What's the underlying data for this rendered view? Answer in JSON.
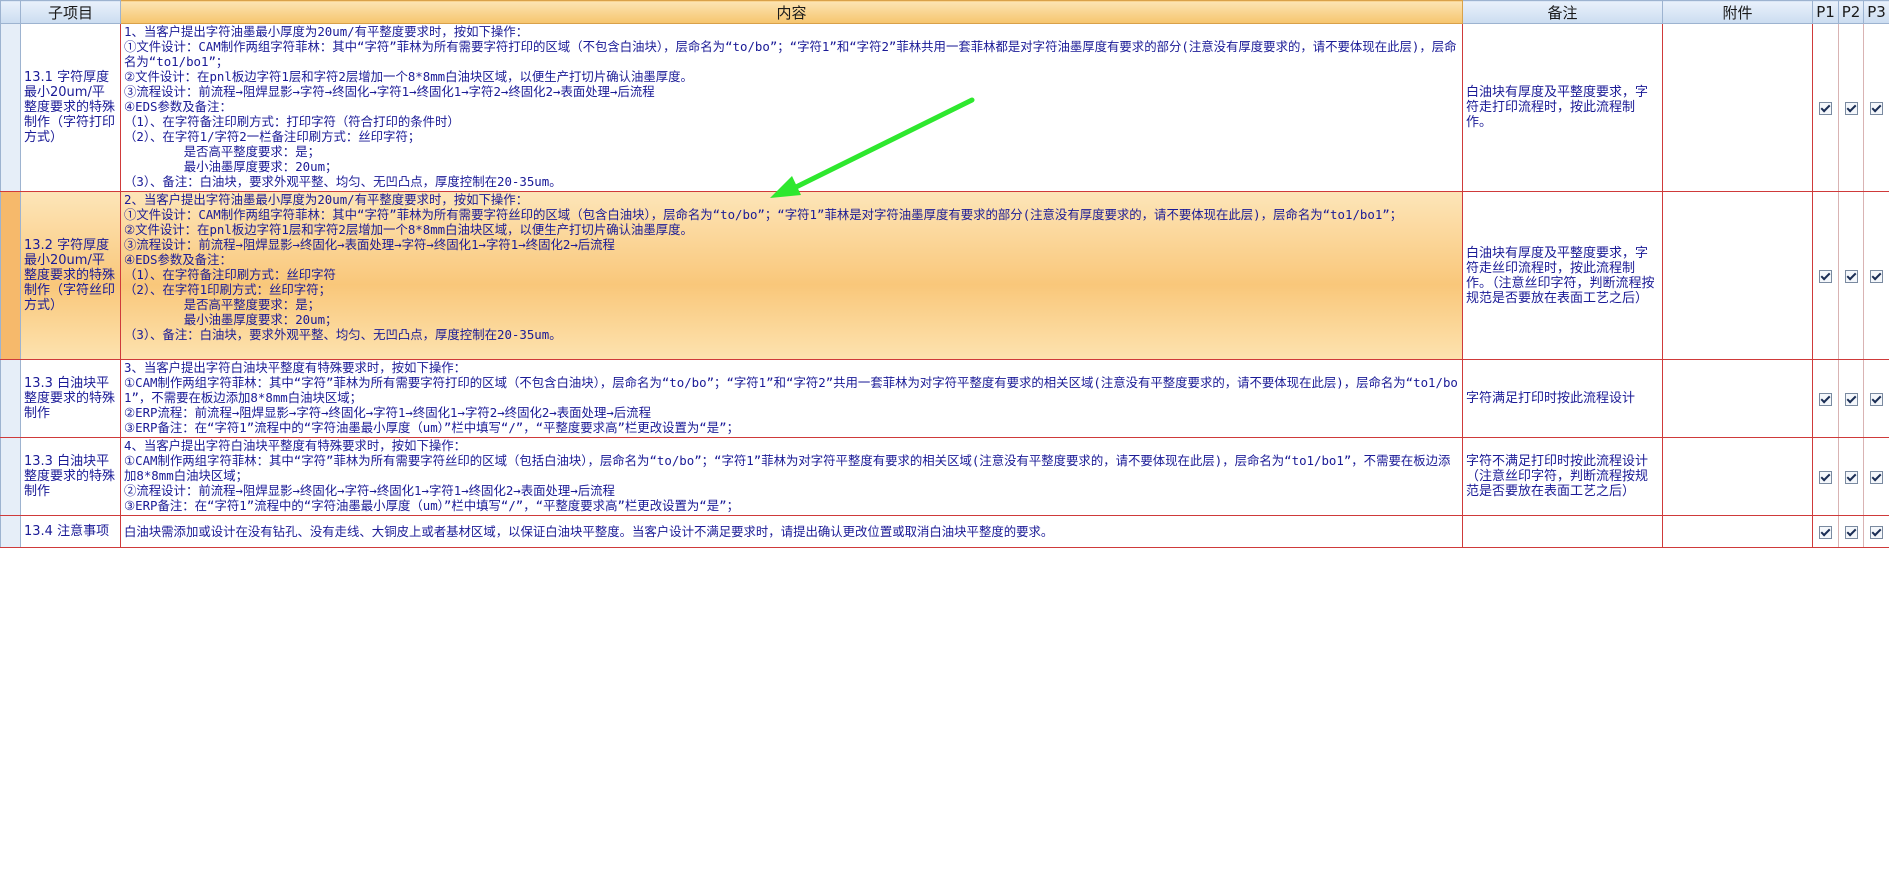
{
  "headers": {
    "subitem": "子项目",
    "content": "内容",
    "remark": "备注",
    "attachment": "附件",
    "p1": "P1",
    "p2": "P2",
    "p3": "P3"
  },
  "rows": [
    {
      "subitem": "13.1 字符厚度最小20um/平整度要求的特殊制作（字符打印方式）",
      "content": "1、当客户提出字符油墨最小厚度为20um/有平整度要求时，按如下操作：\n①文件设计：CAM制作两组字符菲林：其中“字符”菲林为所有需要字符打印的区域（不包含白油块），层命名为“to/bo”；“字符1”和“字符2”菲林共用一套菲林都是对字符油墨厚度有要求的部分(注意没有厚度要求的，请不要体现在此层)，层命名为“to1/bo1”；\n②文件设计：在pnl板边字符1层和字符2层增加一个8*8mm白油块区域，以便生产打切片确认油墨厚度。\n③流程设计：前流程→阻焊显影→字符→终固化→字符1→终固化1→字符2→终固化2→表面处理→后流程\n④EDS参数及备注：\n（1）、在字符备注印刷方式：打印字符（符合打印的条件时）\n（2）、在字符1/字符2一栏备注印刷方式：丝印字符；\n        是否高平整度要求：是；\n        最小油墨厚度要求：20um；\n（3）、备注：白油块，要求外观平整、均匀、无凹凸点，厚度控制在20-35um。",
      "remark": "白油块有厚度及平整度要求，字符走打印流程时，按此流程制作。",
      "attachment": ""
    },
    {
      "subitem": "13.2 字符厚度最小20um/平整度要求的特殊制作（字符丝印方式）",
      "content": "2、当客户提出字符油墨最小厚度为20um/有平整度要求时，按如下操作：\n①文件设计：CAM制作两组字符菲林：其中“字符”菲林为所有需要字符丝印的区域（包含白油块），层命名为“to/bo”；“字符1”菲林是对字符油墨厚度有要求的部分(注意没有厚度要求的，请不要体现在此层)，层命名为“to1/bo1”；\n②文件设计：在pnl板边字符1层和字符2层增加一个8*8mm白油块区域，以便生产打切片确认油墨厚度。\n③流程设计：前流程→阻焊显影→终固化→表面处理→字符→终固化1→字符1→终固化2→后流程\n④EDS参数及备注：\n（1）、在字符备注印刷方式：丝印字符\n（2）、在字符1印刷方式：丝印字符；\n        是否高平整度要求：是；\n        最小油墨厚度要求：20um；\n（3）、备注：白油块，要求外观平整、均匀、无凹凸点，厚度控制在20-35um。",
      "remark": "白油块有厚度及平整度要求，字符走丝印流程时，按此流程制作。（注意丝印字符，判断流程按规范是否要放在表面工艺之后）",
      "attachment": ""
    },
    {
      "subitem": "13.3 白油块平整度要求的特殊制作",
      "content": "3、当客户提出字符白油块平整度有特殊要求时，按如下操作：\n①CAM制作两组字符菲林：其中“字符”菲林为所有需要字符打印的区域（不包含白油块），层命名为“to/bo”；“字符1”和“字符2”共用一套菲林为对字符平整度有要求的相关区域(注意没有平整度要求的，请不要体现在此层)，层命名为“to1/bo1”，不需要在板边添加8*8mm白油块区域；\n②ERP流程：前流程→阻焊显影→字符→终固化→字符1→终固化1→字符2→终固化2→表面处理→后流程\n③ERP备注：在“字符1”流程中的“字符油墨最小厚度（um）”栏中填写“/”，“平整度要求高”栏更改设置为“是”；",
      "remark": "字符满足打印时按此流程设计",
      "attachment": ""
    },
    {
      "subitem": "13.3 白油块平整度要求的特殊制作",
      "content": "4、当客户提出字符白油块平整度有特殊要求时，按如下操作：\n①CAM制作两组字符菲林：其中“字符”菲林为所有需要字符丝印的区域（包括白油块），层命名为“to/bo”；“字符1”菲林为对字符平整度有要求的相关区域(注意没有平整度要求的，请不要体现在此层)，层命名为“to1/bo1”，不需要在板边添加8*8mm白油块区域；\n②流程设计：前流程→阻焊显影→终固化→字符→终固化1→字符1→终固化2→表面处理→后流程\n③ERP备注：在“字符1”流程中的“字符油墨最小厚度（um）”栏中填写“/”，“平整度要求高”栏更改设置为“是”；",
      "remark": "字符不满足打印时按此流程设计（注意丝印字符，判断流程按规范是否要放在表面工艺之后）",
      "attachment": ""
    },
    {
      "subitem": "13.4 注意事项",
      "content": "白油块需添加或设计在没有钻孔、没有走线、大铜皮上或者基材区域，以保证白油块平整度。当客户设计不满足要求时，请提出确认更改位置或取消白油块平整度的要求。",
      "remark": "",
      "attachment": ""
    }
  ],
  "checkboxes": [
    {
      "p1": true,
      "p2": true,
      "p3": true
    },
    {
      "p1": true,
      "p2": true,
      "p3": true
    },
    {
      "p1": true,
      "p2": true,
      "p3": true
    },
    {
      "p1": true,
      "p2": true,
      "p3": true
    },
    {
      "p1": true,
      "p2": true,
      "p3": true
    }
  ],
  "colors": {
    "header_bg": "#d6e4f5",
    "active_row": "#f9c77a",
    "cell_text": "#1a1a96",
    "grid_border": "#cf3a3a",
    "arrow": "#2ee82e"
  },
  "active_row_index": 1,
  "annotation": {
    "icon": "green-arrow-icon"
  }
}
